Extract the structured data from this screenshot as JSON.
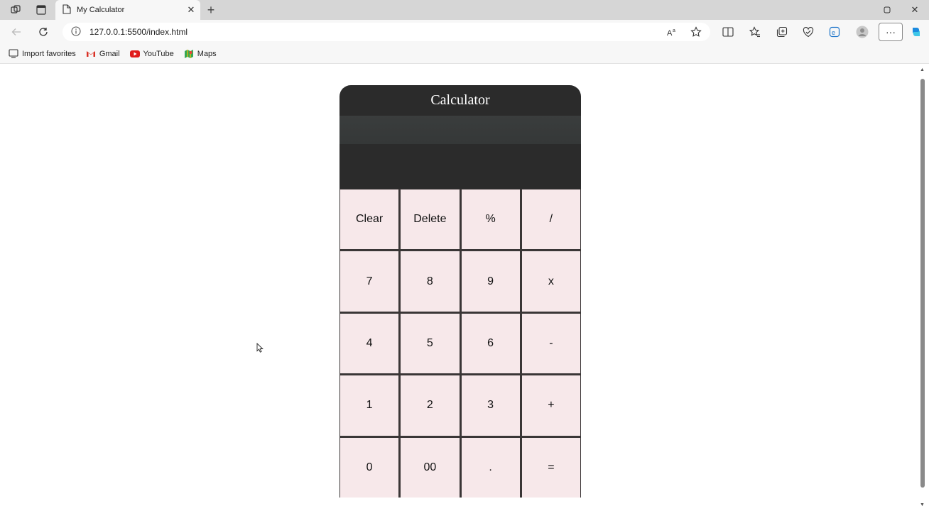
{
  "browser": {
    "tab_title": "My Calculator",
    "url": "127.0.0.1:5500/index.html",
    "more_label": "···",
    "bookmarks": [
      {
        "label": "Import favorites",
        "icon": "import-icon"
      },
      {
        "label": "Gmail",
        "icon": "gmail-icon"
      },
      {
        "label": "YouTube",
        "icon": "youtube-icon"
      },
      {
        "label": "Maps",
        "icon": "maps-icon"
      }
    ]
  },
  "calculator": {
    "title": "Calculator",
    "display": "",
    "keys": [
      [
        "Clear",
        "Delete",
        "%",
        "/"
      ],
      [
        "7",
        "8",
        "9",
        "x"
      ],
      [
        "4",
        "5",
        "6",
        "-"
      ],
      [
        "1",
        "2",
        "3",
        "+"
      ],
      [
        "0",
        "00",
        ".",
        "="
      ]
    ]
  },
  "colors": {
    "calc_body": "#2b2b2b",
    "key_bg": "#f7e8ea",
    "key_grid": "#3a3636"
  }
}
